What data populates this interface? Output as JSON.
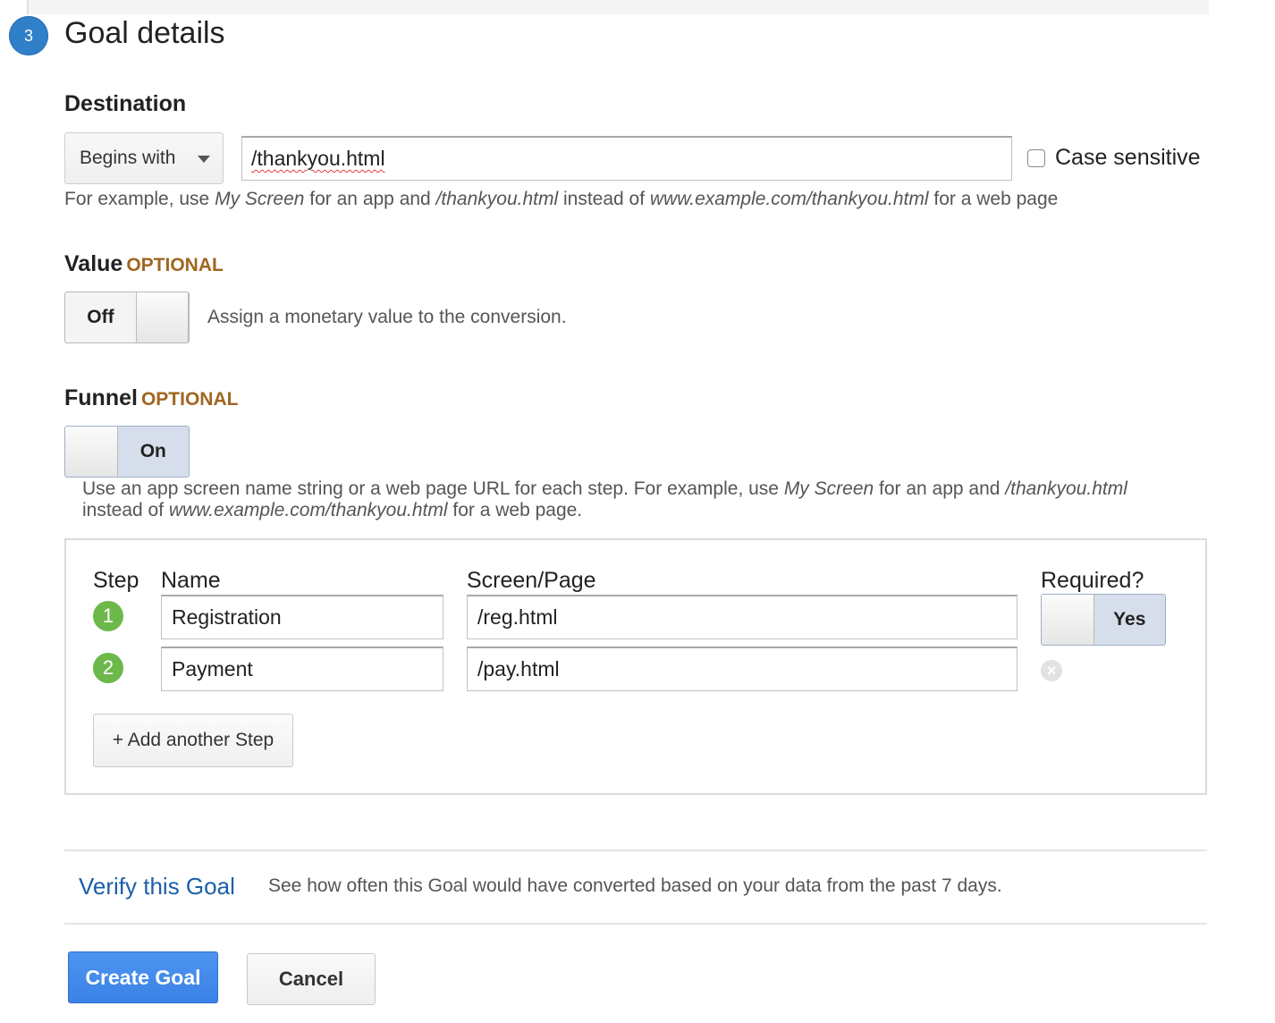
{
  "section": {
    "number": "3",
    "title": "Goal details"
  },
  "destination": {
    "heading": "Destination",
    "match_type": "Begins with",
    "value": "/thankyou.html",
    "case_sensitive_label": "Case sensitive",
    "case_sensitive_checked": false,
    "hint": {
      "p1": "For example, use ",
      "i1": "My Screen",
      "p2": " for an app and ",
      "i2": "/thankyou.html",
      "p3": " instead of ",
      "i3": "www.example.com/thankyou.html",
      "p4": " for a web page"
    }
  },
  "value_section": {
    "heading": "Value",
    "optional": "OPTIONAL",
    "toggle_label": "Off",
    "description": "Assign a monetary value to the conversion."
  },
  "funnel": {
    "heading": "Funnel",
    "optional": "OPTIONAL",
    "toggle_label": "On",
    "hint": {
      "p1": "Use an app screen name string or a web page URL for each step. For example, use ",
      "i1": "My Screen",
      "p2": " for an app and ",
      "i2": "/thankyou.html",
      "p3": "instead of ",
      "i3": "www.example.com/thankyou.html",
      "p4": " for a web page."
    },
    "columns": {
      "step": "Step",
      "name": "Name",
      "page": "Screen/Page",
      "required": "Required?"
    },
    "steps": [
      {
        "number": "1",
        "name": "Registration",
        "page": "/reg.html"
      },
      {
        "number": "2",
        "name": "Payment",
        "page": "/pay.html"
      }
    ],
    "required_toggle_label": "Yes",
    "remove_symbol": "×",
    "add_step_label": "+ Add another Step"
  },
  "verify": {
    "link": "Verify this Goal",
    "text": "See how often this Goal would have converted based on your data from the past 7 days."
  },
  "actions": {
    "create": "Create Goal",
    "cancel": "Cancel"
  },
  "colors": {
    "accent": "#2f7fc9",
    "optional": "#a0661f",
    "step_badge": "#6db84a",
    "primary_button": "#4d94f0",
    "link": "#1c5fa8"
  }
}
